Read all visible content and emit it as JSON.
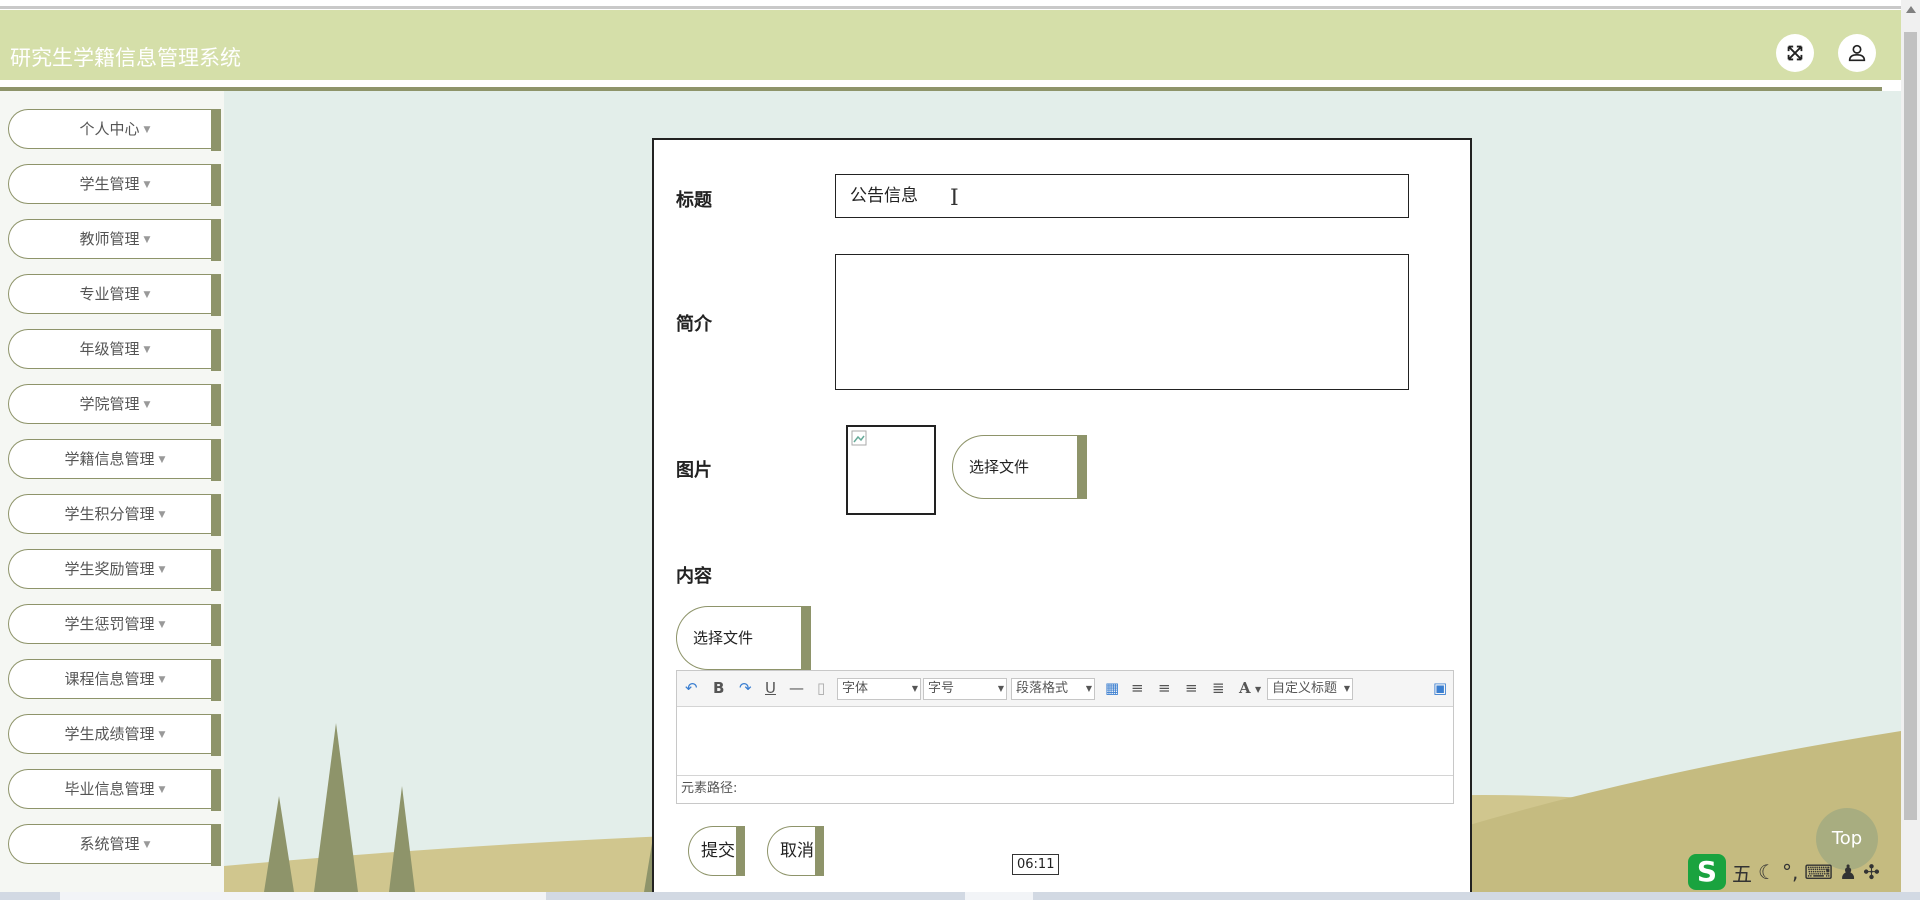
{
  "header": {
    "title": "研究生学籍信息管理系统",
    "fullscreen_icon": "expand-arrows-icon",
    "user_icon": "user-icon"
  },
  "sidebar": {
    "items": [
      {
        "label": "个人中心"
      },
      {
        "label": "学生管理"
      },
      {
        "label": "教师管理"
      },
      {
        "label": "专业管理"
      },
      {
        "label": "年级管理"
      },
      {
        "label": "学院管理"
      },
      {
        "label": "学籍信息管理"
      },
      {
        "label": "学生积分管理"
      },
      {
        "label": "学生奖励管理"
      },
      {
        "label": "学生惩罚管理"
      },
      {
        "label": "课程信息管理"
      },
      {
        "label": "学生成绩管理"
      },
      {
        "label": "毕业信息管理"
      },
      {
        "label": "系统管理"
      }
    ]
  },
  "form": {
    "title_label": "标题",
    "title_value": "公告信息",
    "intro_label": "简介",
    "intro_value": "",
    "image_label": "图片",
    "image_choose": "选择文件",
    "content_label": "内容",
    "content_choose": "选择文件",
    "editor": {
      "font_select": "字体",
      "size_select": "字号",
      "paragraph_select": "段落格式",
      "custom_title_select": "自定义标题",
      "path_label": "元素路径:"
    },
    "submit": "提交",
    "cancel": "取消"
  },
  "top_button": "Top",
  "tooltip_time": "06:11",
  "ime": {
    "mode": "五",
    "logo": "S"
  },
  "colors": {
    "header_bg": "#d5dfa9",
    "accent": "#8e946a",
    "main_bg": "#e3eeea",
    "hill": "#d0c68e"
  }
}
